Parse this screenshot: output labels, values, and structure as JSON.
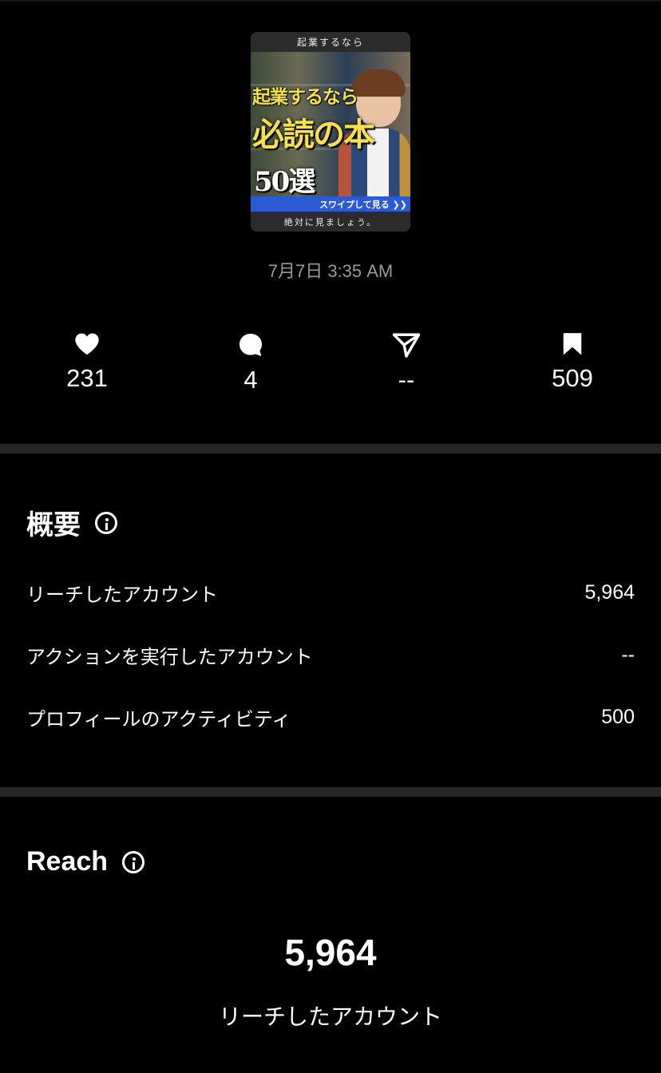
{
  "post": {
    "thumbnail": {
      "top_banner": "起業するなら",
      "headline_1": "起業するなら",
      "headline_2": "必読の本",
      "headline_3": "50選",
      "swipe_label": "スワイプして見る ❯❯",
      "bottom_banner": "絶対に見ましょう。"
    },
    "date": "7月7日 3:35 AM"
  },
  "stats": {
    "likes": {
      "icon": "heart-icon",
      "value": "231"
    },
    "comments": {
      "icon": "comment-icon",
      "value": "4"
    },
    "shares": {
      "icon": "send-icon",
      "value": "--"
    },
    "saves": {
      "icon": "bookmark-icon",
      "value": "509"
    }
  },
  "overview": {
    "title": "概要",
    "rows": [
      {
        "label": "リーチしたアカウント",
        "value": "5,964"
      },
      {
        "label": "アクションを実行したアカウント",
        "value": "--"
      },
      {
        "label": "プロフィールのアクティビティ",
        "value": "500"
      }
    ]
  },
  "reach": {
    "title": "Reach",
    "value": "5,964",
    "label": "リーチしたアカウント"
  },
  "colors": {
    "background": "#000000",
    "divider": "#262626",
    "muted_text": "#9a9a9a",
    "thumbnail_accent": "#f6e04b",
    "swipe_bar": "#2b5ad2"
  }
}
